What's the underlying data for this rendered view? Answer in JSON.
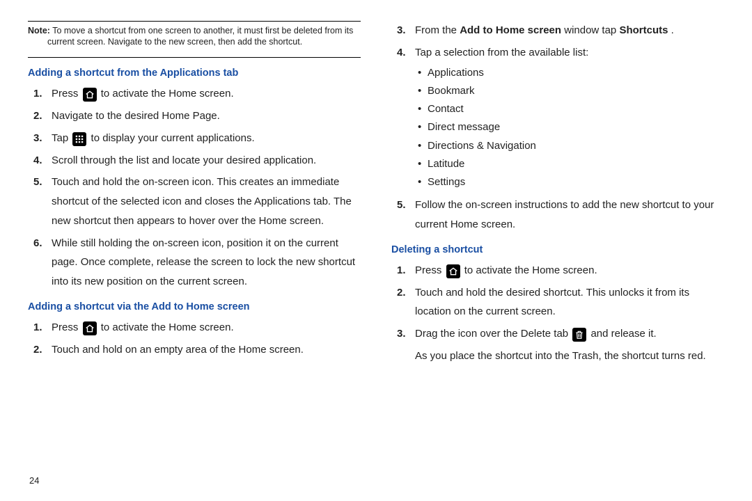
{
  "note": {
    "label": "Note:",
    "text": "To move a shortcut from one screen to another, it must first be deleted from its current screen. Navigate to the new screen, then add the shortcut."
  },
  "sectionA": {
    "title": "Adding a shortcut from the Applications tab",
    "s1a": "Press ",
    "s1b": " to activate the Home screen.",
    "s2": "Navigate to the desired Home Page.",
    "s3a": "Tap ",
    "s3b": " to display your current applications.",
    "s4": "Scroll through the list and locate your desired application.",
    "s5": "Touch and hold the on-screen icon. This creates an immediate shortcut of the selected icon and closes the Applications tab. The new shortcut then appears to hover over the Home screen.",
    "s6": "While still holding the on-screen icon, position it on the current page. Once complete, release the screen to lock the new shortcut into its new position on the current screen."
  },
  "sectionB": {
    "title": "Adding a shortcut via the Add to Home screen",
    "s1a": "Press ",
    "s1b": " to activate the Home screen.",
    "s2": "Touch and hold on an empty area of the Home screen.",
    "s3a": "From the ",
    "s3b": "Add to Home screen",
    "s3c": " window tap ",
    "s3d": "Shortcuts",
    "s3e": ".",
    "s4": "Tap a selection from the available list:",
    "bullets": {
      "b1": "Applications",
      "b2": "Bookmark",
      "b3": "Contact",
      "b4": "Direct message",
      "b5": "Directions & Navigation",
      "b6": "Latitude",
      "b7": "Settings"
    },
    "s5": "Follow the on-screen instructions to add the new shortcut to your current Home screen."
  },
  "sectionC": {
    "title": "Deleting a shortcut",
    "s1a": "Press ",
    "s1b": " to activate the Home screen.",
    "s2": "Touch and hold the desired shortcut. This unlocks it from its location on the current screen.",
    "s3a": "Drag the icon over the Delete tab ",
    "s3b": " and release it.",
    "tail": "As you place the shortcut into the Trash, the shortcut turns red."
  },
  "pagenum": "24"
}
